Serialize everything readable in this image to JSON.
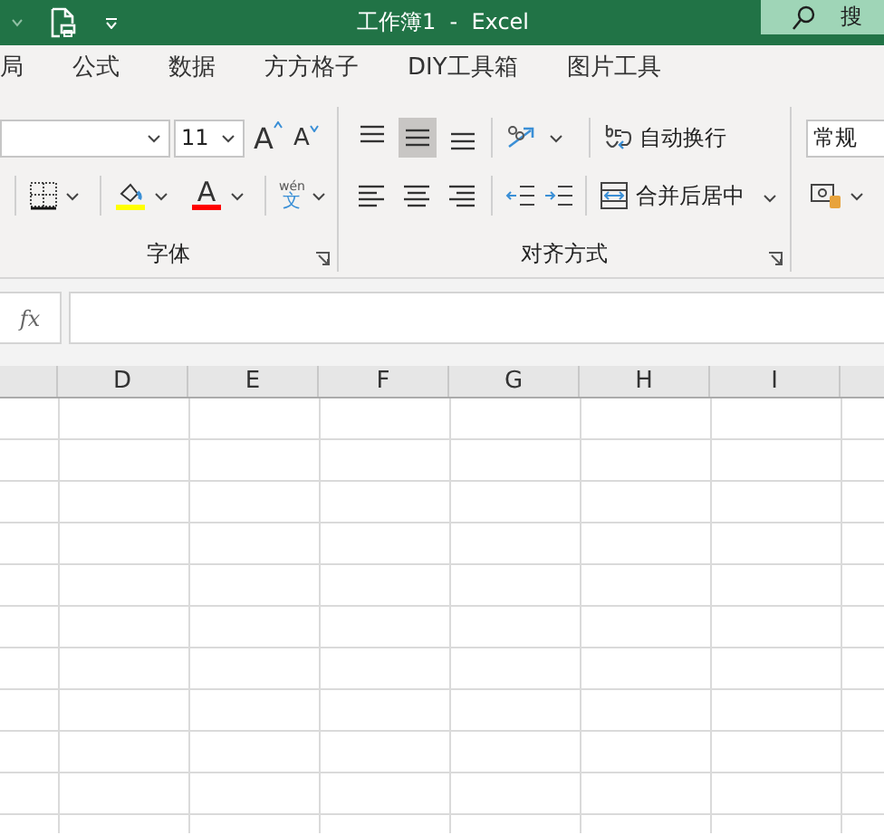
{
  "title_bar": {
    "title": "工作簿1  -  Excel",
    "search": {
      "placeholder": "搜"
    }
  },
  "tabs": [
    {
      "label": "局",
      "selected": false
    },
    {
      "label": "公式",
      "selected": false
    },
    {
      "label": "数据",
      "selected": false
    },
    {
      "label": "方方格子",
      "selected": false
    },
    {
      "label": "DIY工具箱",
      "selected": false
    },
    {
      "label": "图片工具",
      "selected": false
    }
  ],
  "font_group": {
    "label": "字体",
    "font_size": "11",
    "grow_font": "A",
    "shrink_font": "A",
    "fill_color": {
      "color": "#ffff00"
    },
    "font_color": {
      "label": "A",
      "color": "#ff0000"
    },
    "phonetic": {
      "pinyin": "wén",
      "hanzi": "文"
    }
  },
  "alignment_group": {
    "label": "对齐方式",
    "vertical": [
      {
        "kind": "top",
        "selected": false
      },
      {
        "kind": "middle",
        "selected": true
      },
      {
        "kind": "bottom",
        "selected": false
      }
    ],
    "horizontal": [
      {
        "kind": "left",
        "selected": false
      },
      {
        "kind": "center",
        "selected": false
      },
      {
        "kind": "right",
        "selected": false
      }
    ],
    "wrap_text": "自动换行",
    "merge_center": "合并后居中"
  },
  "number_group": {
    "format": "常规"
  },
  "formula_bar": {
    "fx": "fx"
  },
  "columns": [
    {
      "label": "D"
    },
    {
      "label": "E"
    },
    {
      "label": "F"
    },
    {
      "label": "G"
    },
    {
      "label": "H"
    },
    {
      "label": "I"
    }
  ]
}
